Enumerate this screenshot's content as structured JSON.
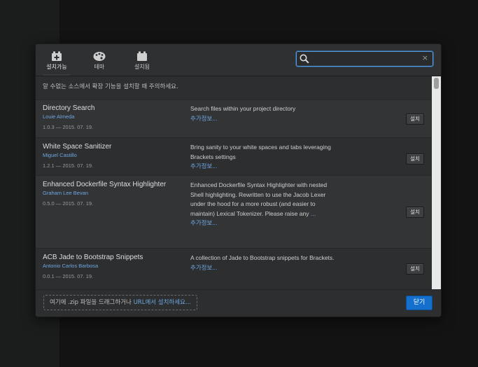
{
  "tabs": [
    {
      "label": "설치가능",
      "icon": "available-icon",
      "active": true
    },
    {
      "label": "테마",
      "icon": "palette-icon",
      "active": false
    },
    {
      "label": "설치됨",
      "icon": "installed-icon",
      "active": false
    }
  ],
  "search": {
    "value": "",
    "placeholder": "",
    "clear_label": "×"
  },
  "warning": "알 수없는 소스에서 확장 기능을 설치할 때 주의하세요.",
  "extensions": [
    {
      "name": "Directory Search",
      "author": "Louie Almeda",
      "version": "1.0.3 — 2015. 07. 19.",
      "description": "Search files within your project directory",
      "more": "추가정보...",
      "install": "설치"
    },
    {
      "name": "White Space Sanitizer",
      "author": "Miguel Castillo",
      "version": "1.2.1 — 2015. 07. 19.",
      "description": "Bring sanity to your white spaces and tabs leveraging Brackets settings",
      "more": "추가정보...",
      "install": "설치"
    },
    {
      "name": "Enhanced Dockerfile Syntax Highlighter",
      "author": "Graham Lee Bevan",
      "version": "0.5.0 — 2015. 07. 19.",
      "description": "Enhanced Dockerfile Syntax Highlighter with nested Shell highlighting. Rewritten to use the Jacob Lexer under the hood for a more robust (and easier to maintain) Lexical Tokenizer. Please raise any",
      "ellipsis": "...",
      "more": "추가정보...",
      "install": "설치"
    },
    {
      "name": "ACB Jade to Bootstrap Snippets",
      "author": "Antonio Carlos Barbosa",
      "version": "0.0.1 — 2015. 07. 19.",
      "description": "A collection of Jade to Bootstrap snippets for Brackets.",
      "more": "추가정보...",
      "install": "설치"
    }
  ],
  "footer": {
    "drop_prefix": "여기에 .zip 파일을 드래그하거나 ",
    "drop_link": "URL에서 설치하세요...",
    "close": "닫기"
  },
  "colors": {
    "accent": "#1470cc",
    "link": "#6ea7e0",
    "background": "#2d2e30"
  }
}
